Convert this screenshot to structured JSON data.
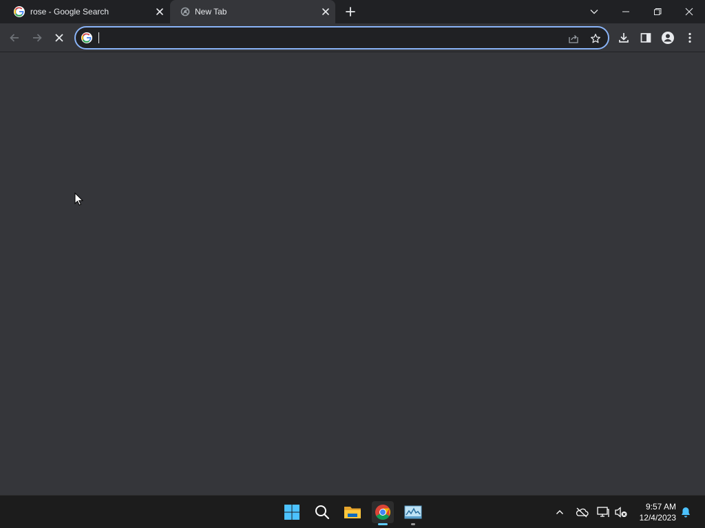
{
  "tabs": [
    {
      "title": "rose - Google Search",
      "favicon": "google-icon",
      "active": false
    },
    {
      "title": "New Tab",
      "favicon": "chrome-newtab-icon",
      "active": true
    }
  ],
  "omnibox": {
    "value": "",
    "placeholder": ""
  },
  "toolbar_icons": [
    "back-icon",
    "forward-icon",
    "stop-icon",
    "share-icon",
    "star-icon",
    "download-icon",
    "side-panel-icon",
    "profile-icon",
    "menu-icon"
  ],
  "taskbar": {
    "apps": [
      "windows-start-icon",
      "search-icon",
      "file-explorer-icon",
      "chrome-icon",
      "task-manager-icon"
    ],
    "tray_icons": [
      "chevron-up-icon",
      "onedrive-icon",
      "network-icon",
      "volume-muted-icon"
    ],
    "time": "9:57 AM",
    "date": "12/4/2023"
  },
  "colors": {
    "tabstrip": "#202124",
    "page": "#35363a",
    "accent": "#8ab4f8",
    "taskbar": "#1c1c1c",
    "indicator": "#60cdff"
  }
}
